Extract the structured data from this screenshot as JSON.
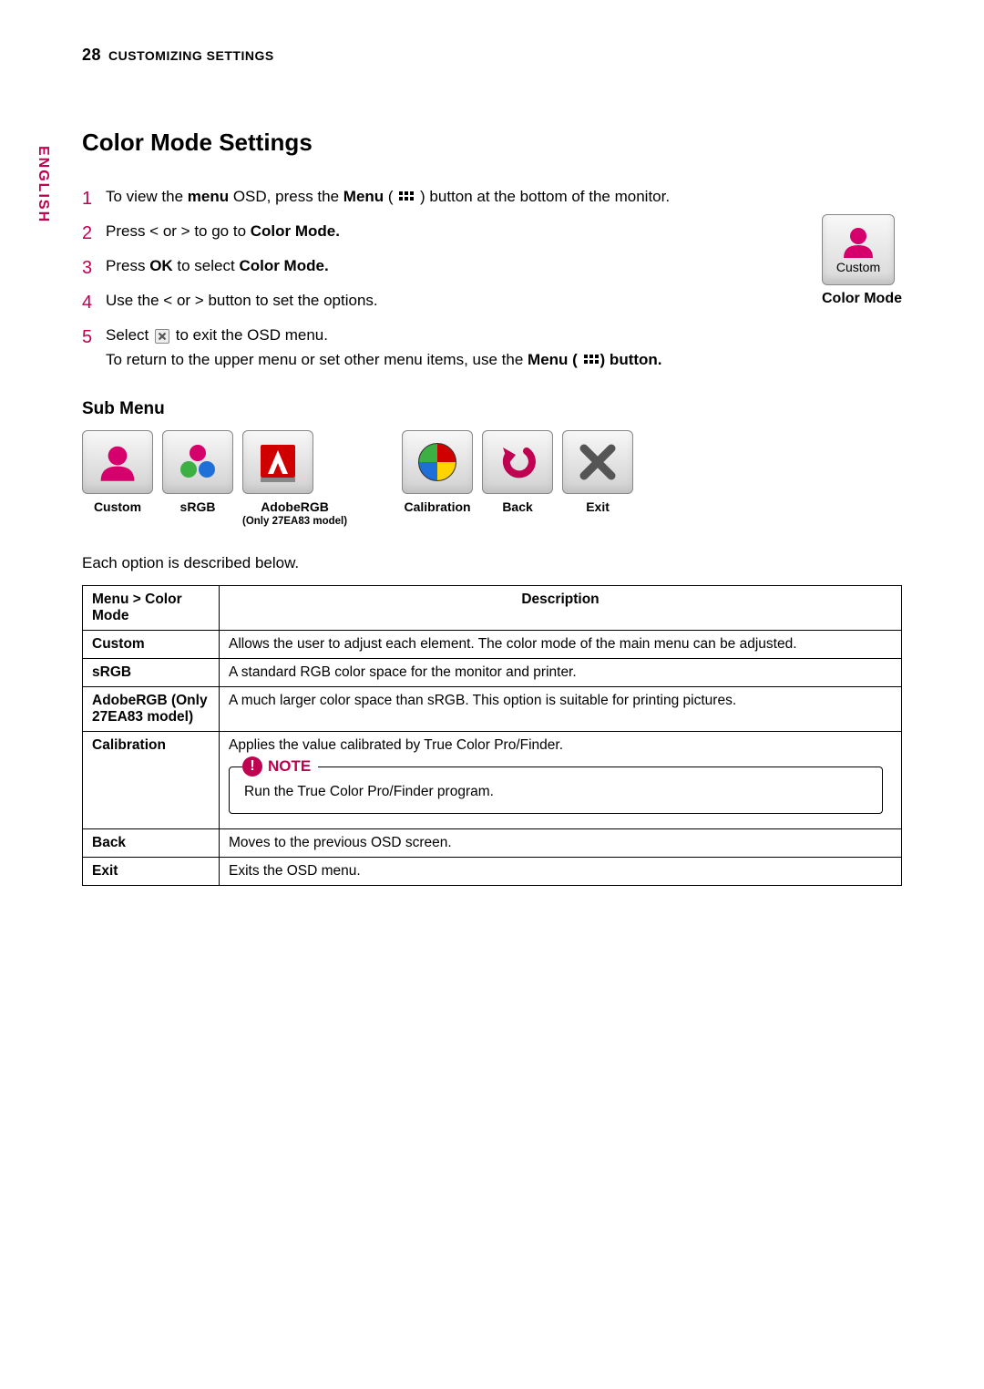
{
  "header": {
    "page_number": "28",
    "section": "CUSTOMIZING SETTINGS"
  },
  "language_tab": "ENGLISH",
  "title": "Color Mode Settings",
  "steps": {
    "s1_a": "To view the ",
    "s1_b": "menu",
    "s1_c": " OSD, press the ",
    "s1_d": "Menu",
    "s1_e": " (",
    "s1_f": " ) button at the bottom of the monitor.",
    "s2_a": "Press < or > to go to ",
    "s2_b": "Color Mode.",
    "s3_a": "Press ",
    "s3_b": "OK",
    "s3_c": " to select ",
    "s3_d": "Color Mode.",
    "s4": "Use the < or > button to set the options.",
    "s5_a": "Select ",
    "s5_b": " to exit the OSD menu.",
    "s5_c": "To return to the upper menu or set other menu items, use the ",
    "s5_d": "Menu (",
    "s5_e": ") button."
  },
  "side_card": {
    "icon_label": "Custom",
    "caption": "Color Mode"
  },
  "sub_menu_heading": "Sub Menu",
  "submenu": {
    "custom": "Custom",
    "srgb": "sRGB",
    "adobe": "AdobeRGB",
    "adobe_note": "(Only 27EA83 model)",
    "calibration": "Calibration",
    "back": "Back",
    "exit": "Exit"
  },
  "table_intro": "Each option is described below.",
  "table": {
    "head_name": "Menu > Color Mode",
    "head_desc": "Description",
    "rows": {
      "r1_name": "Custom",
      "r1_desc": "Allows the user to adjust each element. The color mode of the main menu can be adjusted.",
      "r2_name": "sRGB",
      "r2_desc": "A standard RGB color space for the monitor and printer.",
      "r3_name": "AdobeRGB (Only 27EA83 model)",
      "r3_desc": "A much larger color space than sRGB. This option is suitable for printing pictures.",
      "r4_name": "Calibration",
      "r4_desc": "Applies the value calibrated by True Color Pro/Finder.",
      "r4_note_title": "NOTE",
      "r4_note_body": "Run the True Color Pro/Finder program.",
      "r5_name": "Back",
      "r5_desc": "Moves to the previous OSD screen.",
      "r6_name": "Exit",
      "r6_desc": "Exits the OSD menu."
    }
  }
}
